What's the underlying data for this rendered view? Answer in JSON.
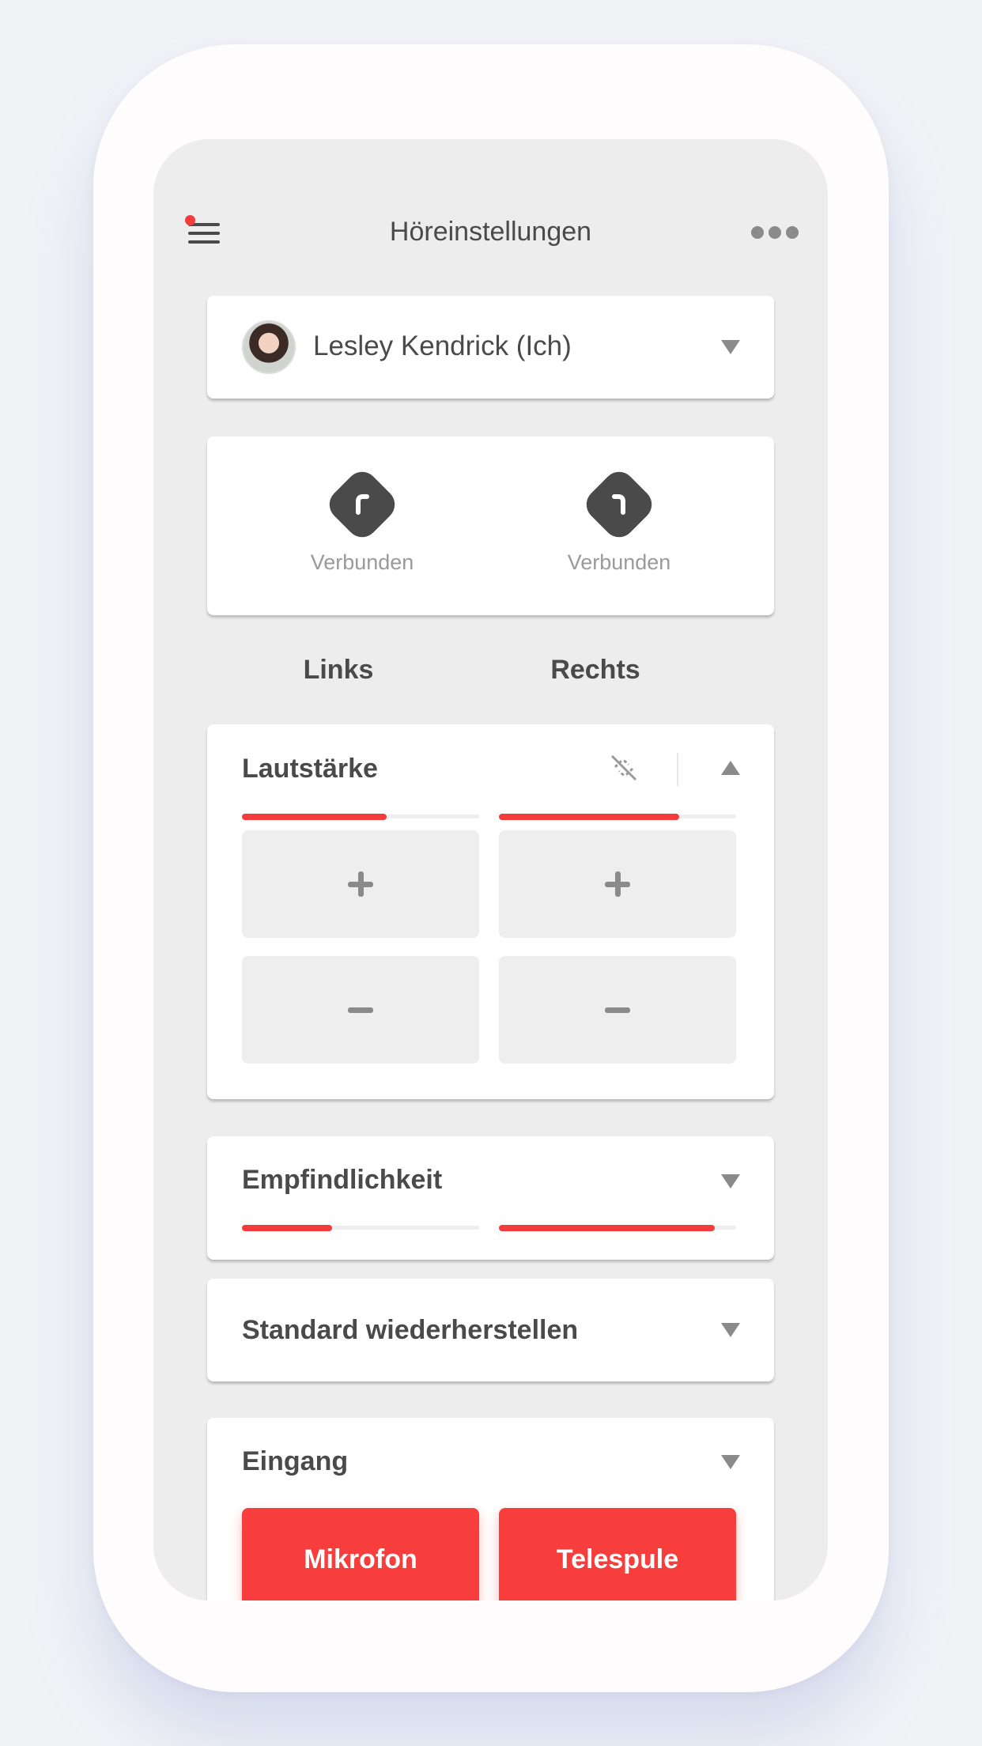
{
  "header": {
    "title": "Höreinstellungen",
    "menu_icon": "hamburger-menu-icon",
    "more_icon": "more-dots-icon",
    "notification_color": "#f53c3c"
  },
  "profile": {
    "name": "Lesley Kendrick (Ich)",
    "dropdown_icon": "triangle-down-icon"
  },
  "devices": {
    "left": {
      "status": "Verbunden",
      "icon": "hearing-aid-left-icon"
    },
    "right": {
      "status": "Verbunden",
      "icon": "hearing-aid-right-icon"
    }
  },
  "sides": {
    "left": "Links",
    "right": "Rechts"
  },
  "volume": {
    "title": "Lautstärke",
    "unlink_icon": "unlink-icon",
    "collapse_icon": "triangle-up-icon",
    "left_level": 0.61,
    "right_level": 0.76,
    "plus_label": "+",
    "minus_label": "−"
  },
  "sensitivity": {
    "title": "Empfindlichkeit",
    "left_level": 0.38,
    "right_level": 0.91
  },
  "reset": {
    "title": "Standard wiederherstellen"
  },
  "input": {
    "title": "Eingang",
    "buttons": [
      "Mikrofon",
      "Telespule"
    ]
  },
  "colors": {
    "accent": "#f53c3c",
    "text": "#4a4a4a",
    "muted": "#9a9a9a",
    "background": "#ededed"
  }
}
